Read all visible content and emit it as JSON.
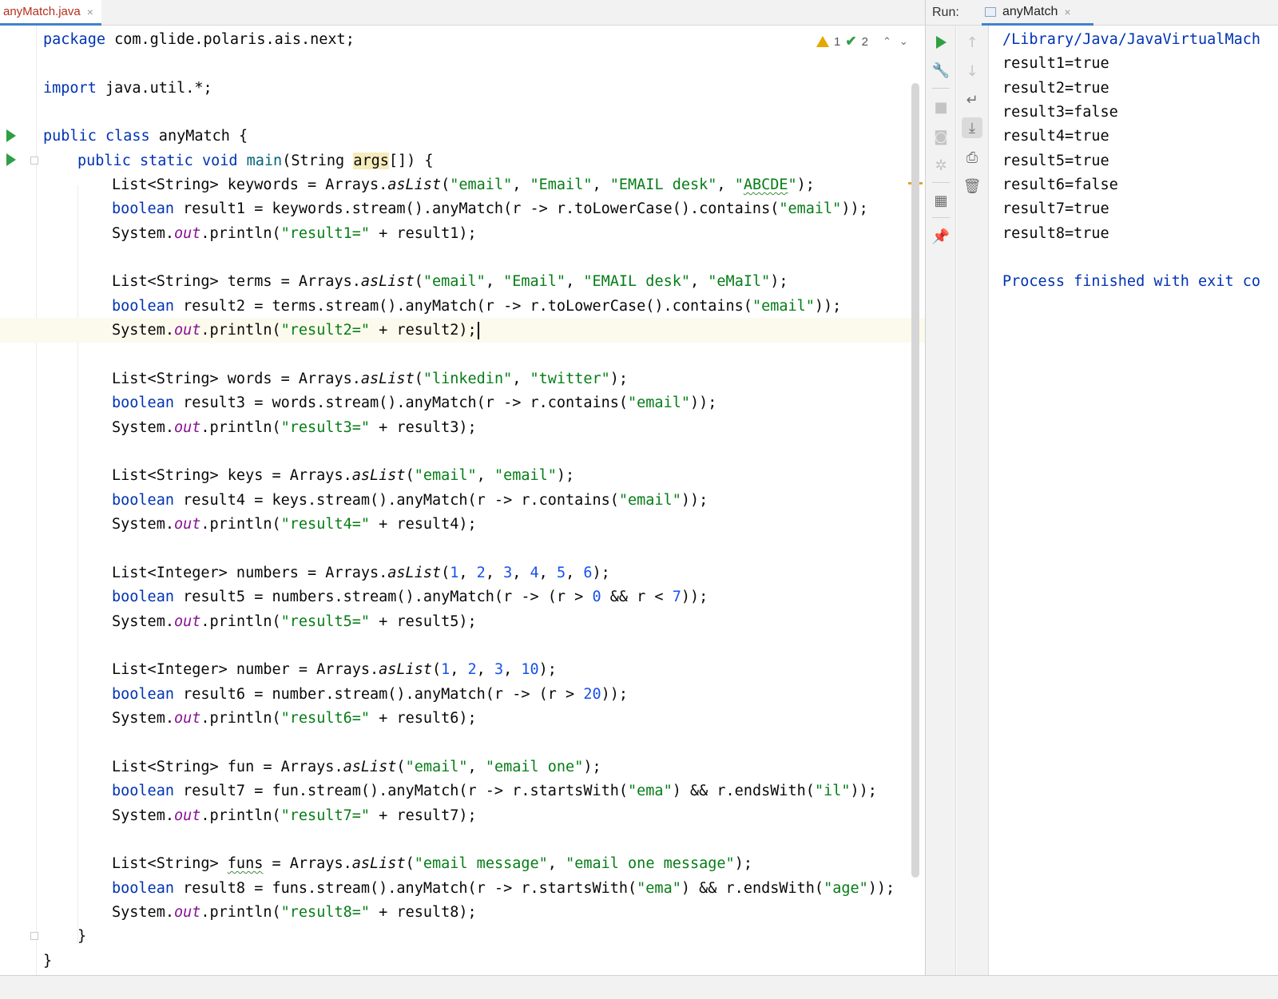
{
  "editor_tab": {
    "label": "anyMatch.java",
    "close": "×"
  },
  "inspections": {
    "warnings": "1",
    "weak_warnings": "2",
    "up": "⌃",
    "down": "⌄"
  },
  "code": {
    "l1": [
      "package",
      " com.glide.polaris.ais.next;"
    ],
    "l3": [
      "import",
      " java.util.*;"
    ],
    "l5": [
      "public",
      " ",
      "class",
      " anyMatch {"
    ],
    "l6": [
      "public",
      " ",
      "static",
      " ",
      "void",
      " ",
      "main",
      "(String ",
      "args",
      "[]) {"
    ],
    "l7": [
      "List<String> keywords = Arrays.",
      "asList",
      "(",
      "\"email\"",
      ", ",
      "\"Email\"",
      ", ",
      "\"EMAIL desk\"",
      ", ",
      "\"",
      "ABCDE",
      "\"",
      ");"
    ],
    "l8": [
      "boolean",
      " result1 = keywords.stream().anyMatch(r -> r.toLowerCase().contains(",
      "\"email\"",
      "));"
    ],
    "l9": [
      "System.",
      "out",
      ".println(",
      "\"result1=\"",
      " + result1);"
    ],
    "l11": [
      "List<String> terms = Arrays.",
      "asList",
      "(",
      "\"email\"",
      ", ",
      "\"Email\"",
      ", ",
      "\"EMAIL desk\"",
      ", ",
      "\"eMaIl\"",
      ");"
    ],
    "l12": [
      "boolean",
      " result2 = terms.stream().anyMatch(r -> r.toLowerCase().contains(",
      "\"email\"",
      "));"
    ],
    "l13": [
      "System.",
      "out",
      ".println(",
      "\"result2=\"",
      " + result2);"
    ],
    "l15": [
      "List<String> words = Arrays.",
      "asList",
      "(",
      "\"linkedin\"",
      ", ",
      "\"twitter\"",
      ");"
    ],
    "l16": [
      "boolean",
      " result3 = words.stream().anyMatch(r -> r.contains(",
      "\"email\"",
      "));"
    ],
    "l17": [
      "System.",
      "out",
      ".println(",
      "\"result3=\"",
      " + result3);"
    ],
    "l19": [
      "List<String> keys = Arrays.",
      "asList",
      "(",
      "\"email\"",
      ", ",
      "\"email\"",
      ");"
    ],
    "l20": [
      "boolean",
      " result4 = keys.stream().anyMatch(r -> r.contains(",
      "\"email\"",
      "));"
    ],
    "l21": [
      "System.",
      "out",
      ".println(",
      "\"result4=\"",
      " + result4);"
    ],
    "l23": [
      "List<Integer> numbers = Arrays.",
      "asList",
      "(",
      "1",
      ", ",
      "2",
      ", ",
      "3",
      ", ",
      "4",
      ", ",
      "5",
      ", ",
      "6",
      ");"
    ],
    "l24": [
      "boolean",
      " result5 = numbers.stream().anyMatch(r -> (r > ",
      "0",
      " && r < ",
      "7",
      "));"
    ],
    "l25": [
      "System.",
      "out",
      ".println(",
      "\"result5=\"",
      " + result5);"
    ],
    "l27": [
      "List<Integer> number = Arrays.",
      "asList",
      "(",
      "1",
      ", ",
      "2",
      ", ",
      "3",
      ", ",
      "10",
      ");"
    ],
    "l28": [
      "boolean",
      " result6 = number.stream().anyMatch(r -> (r > ",
      "20",
      "));"
    ],
    "l29": [
      "System.",
      "out",
      ".println(",
      "\"result6=\"",
      " + result6);"
    ],
    "l31": [
      "List<String> fun = Arrays.",
      "asList",
      "(",
      "\"email\"",
      ", ",
      "\"email one\"",
      ");"
    ],
    "l32": [
      "boolean",
      " result7 = fun.stream().anyMatch(r -> r.startsWith(",
      "\"ema\"",
      ") && r.endsWith(",
      "\"il\"",
      "));"
    ],
    "l33": [
      "System.",
      "out",
      ".println(",
      "\"result7=\"",
      " + result7);"
    ],
    "l35": [
      "List<String> ",
      "funs",
      " = Arrays.",
      "asList",
      "(",
      "\"email message\"",
      ", ",
      "\"email one message\"",
      ");"
    ],
    "l36": [
      "boolean",
      " result8 = funs.stream().anyMatch(r -> r.startsWith(",
      "\"ema\"",
      ") && r.endsWith(",
      "\"age\"",
      "));"
    ],
    "l37": [
      "System.",
      "out",
      ".println(",
      "\"result8=\"",
      " + result8);"
    ],
    "l38": "}",
    "l39": "}"
  },
  "run_window": {
    "title": "Run:",
    "tab_label": "anyMatch",
    "tab_close": "×",
    "tools_left": [
      "rerun-icon",
      "wrench-icon",
      "stop-icon",
      "camera-icon",
      "settings-icon",
      "layout-icon",
      "pin-icon"
    ],
    "tools_right": [
      "arrow-up-icon",
      "arrow-down-icon",
      "soft-wrap-icon",
      "scroll-to-end-icon",
      "print-icon",
      "trash-icon"
    ]
  },
  "console": {
    "command": "/Library/Java/JavaVirtualMach",
    "lines": [
      "result1=true",
      "result2=true",
      "result3=false",
      "result4=true",
      "result5=true",
      "result6=false",
      "result7=true",
      "result8=true"
    ],
    "finished": "Process finished with exit co"
  },
  "colors": {
    "keyword": "#0033b3",
    "string": "#067d17",
    "number": "#1750eb",
    "field": "#871094",
    "run_green": "#2ea043",
    "tab_accent": "#4083c9"
  }
}
